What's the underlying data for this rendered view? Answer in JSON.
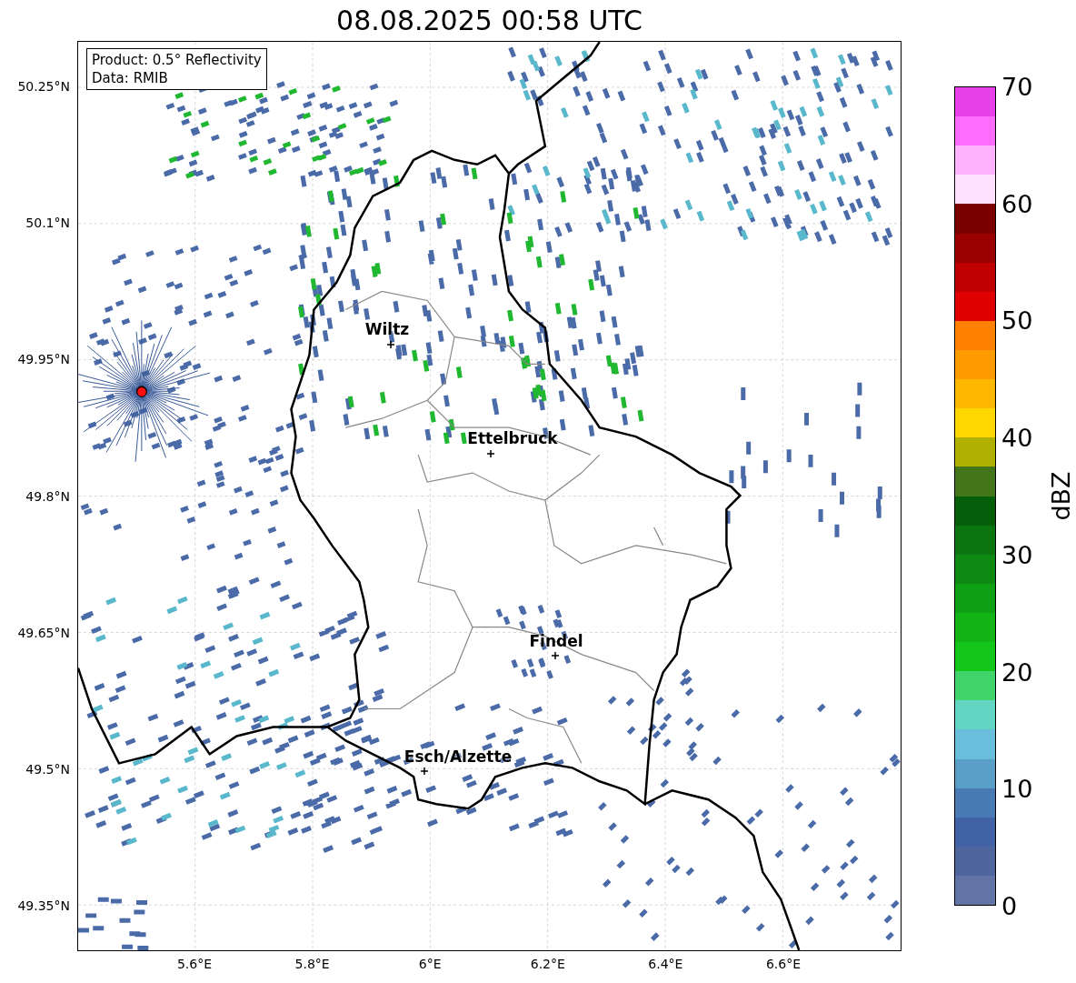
{
  "title": "08.08.2025 00:58 UTC",
  "info_box": {
    "lines": [
      "Product: 0.5° Reflectivity",
      "Data: RMIB"
    ]
  },
  "map": {
    "cities": [
      {
        "name": "Wiltz"
      },
      {
        "name": "Ettelbruck"
      },
      {
        "name": "Findel"
      },
      {
        "name": "Esch/Alzette"
      }
    ],
    "y_ticks": [
      "50.25°N",
      "50.1°N",
      "49.95°N",
      "49.8°N",
      "49.65°N",
      "49.5°N",
      "49.35°N"
    ],
    "x_ticks": [
      "5.6°E",
      "5.8°E",
      "6°E",
      "6.2°E",
      "6.4°E",
      "6.6°E"
    ]
  },
  "colorbar": {
    "label": "dBZ",
    "ticks": [
      "70",
      "60",
      "50",
      "40",
      "30",
      "20",
      "10",
      "0"
    ]
  }
}
